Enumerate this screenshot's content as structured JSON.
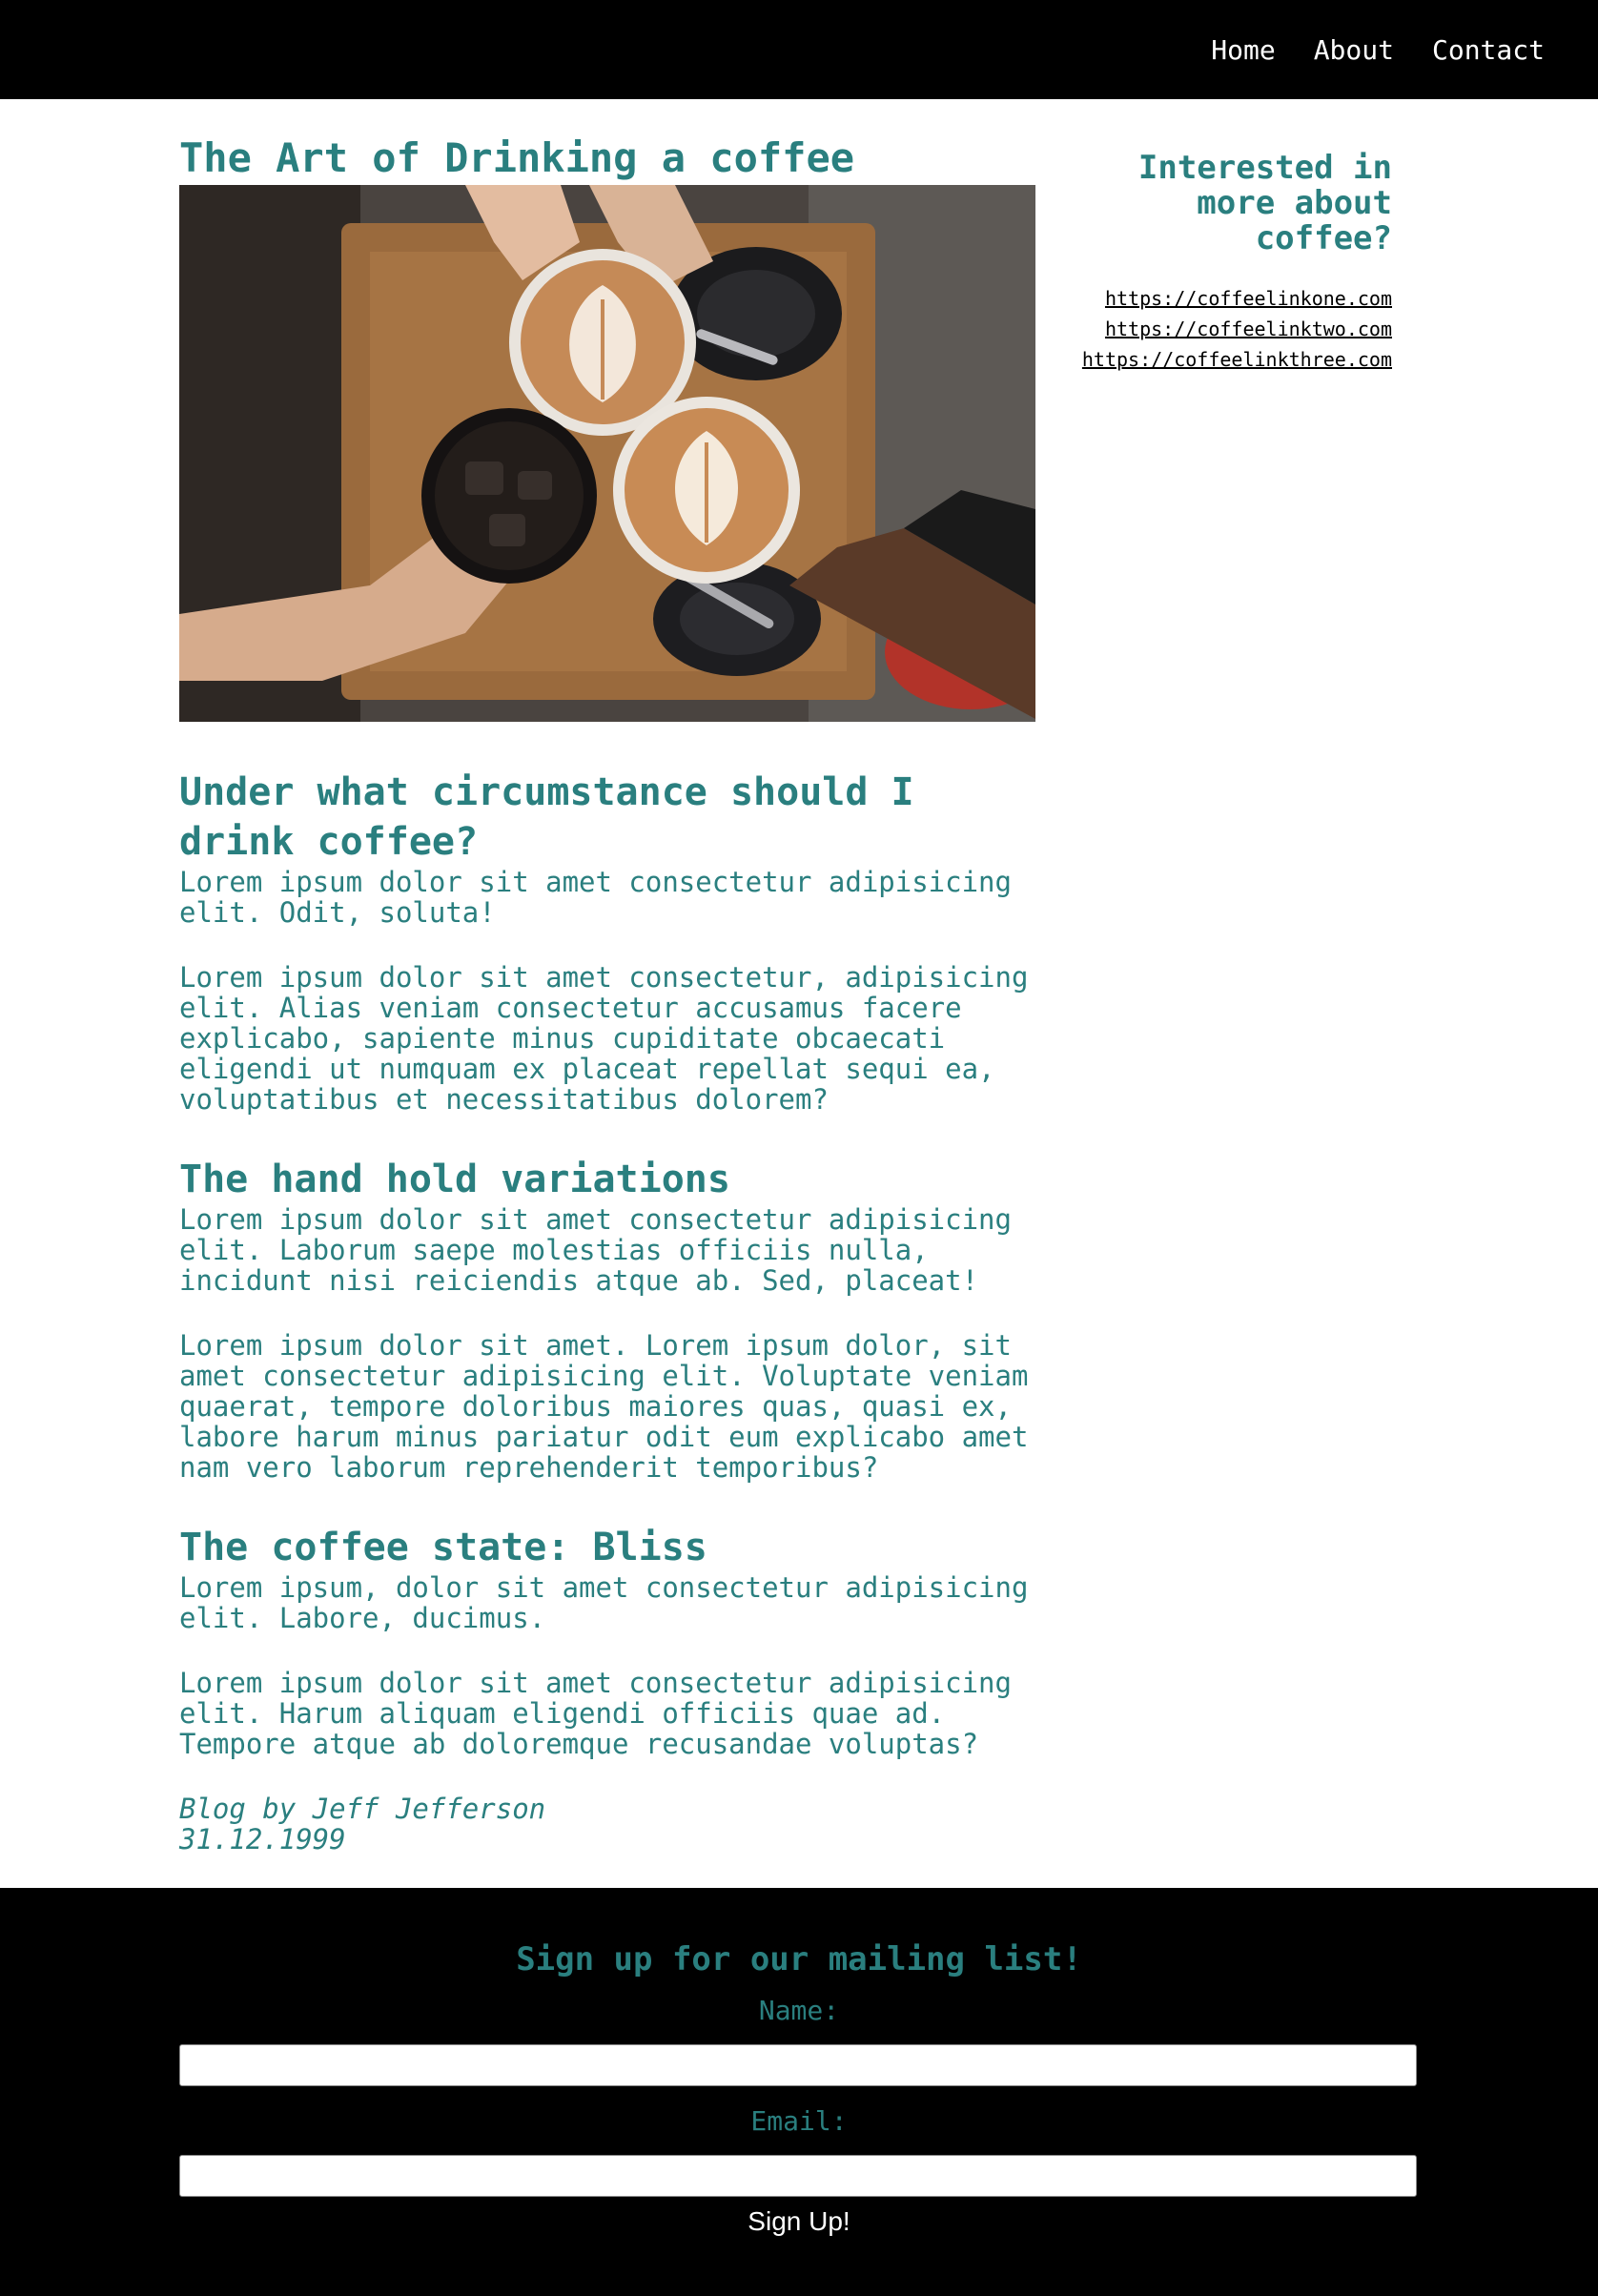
{
  "nav": {
    "items": [
      {
        "label": "Home"
      },
      {
        "label": "About"
      },
      {
        "label": "Contact"
      }
    ]
  },
  "post": {
    "title": "The Art of Drinking a coffee",
    "hero_alt": "Four hands toasting with cups of latte art coffee and iced coffee over a wooden table",
    "sections": [
      {
        "heading": "Under what circumstance should I drink coffee?",
        "paragraphs": [
          "Lorem ipsum dolor sit amet consectetur adipisicing elit. Odit, soluta!",
          "Lorem ipsum dolor sit amet consectetur, adipisicing elit. Alias veniam consectetur accusamus facere explicabo, sapiente minus cupiditate obcaecati eligendi ut numquam ex placeat repellat sequi ea, voluptatibus et necessitatibus dolorem?"
        ]
      },
      {
        "heading": "The hand hold variations",
        "paragraphs": [
          "Lorem ipsum dolor sit amet consectetur adipisicing elit. Laborum saepe molestias officiis nulla, incidunt nisi reiciendis atque ab. Sed, placeat!",
          "Lorem ipsum dolor sit amet. Lorem ipsum dolor, sit amet consectetur adipisicing elit. Voluptate veniam quaerat, tempore doloribus maiores quas, quasi ex, labore harum minus pariatur odit eum explicabo amet nam vero laborum reprehenderit temporibus?"
        ]
      },
      {
        "heading": "The coffee state: Bliss",
        "paragraphs": [
          "Lorem ipsum, dolor sit amet consectetur adipisicing elit. Labore, ducimus.",
          "Lorem ipsum dolor sit amet consectetur adipisicing elit. Harum aliquam eligendi officiis quae ad. Tempore atque ab doloremque recusandae voluptas?"
        ]
      }
    ],
    "byline": "Blog by Jeff Jefferson",
    "date": "31.12.1999"
  },
  "sidebar": {
    "title": "Interested in more about coffee?",
    "links": [
      {
        "label": "https://coffeelinkone.com"
      },
      {
        "label": "https://coffeelinktwo.com"
      },
      {
        "label": "https://coffeelinkthree.com"
      }
    ]
  },
  "signup": {
    "title": "Sign up for our mailing list!",
    "name_label": "Name:",
    "name_value": "",
    "email_label": "Email:",
    "email_value": "",
    "button_label": "Sign Up!"
  },
  "colors": {
    "accent": "#2a7f7f",
    "nav_bg": "#000000",
    "footer_bg": "#000000",
    "nav_text": "#ffffff"
  }
}
